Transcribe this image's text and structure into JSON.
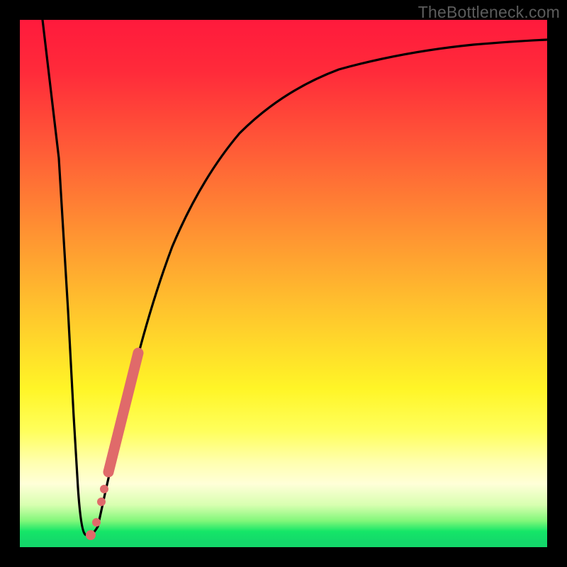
{
  "watermark": "TheBottleneck.com",
  "chart_data": {
    "type": "line",
    "title": "",
    "xlabel": "",
    "ylabel": "",
    "xlim": [
      0,
      100
    ],
    "ylim": [
      0,
      100
    ],
    "background_gradient": {
      "top": "#ff1a3c",
      "mid_upper": "#ff9132",
      "mid": "#fff527",
      "mid_lower": "#ffffb0",
      "bottom": "#13d86a"
    },
    "series": [
      {
        "name": "bottleneck-curve",
        "color": "#000000",
        "x": [
          4,
          6,
          8,
          9,
          10,
          11,
          12,
          13,
          14,
          15,
          17,
          19,
          21,
          24,
          27,
          31,
          36,
          42,
          50,
          60,
          72,
          85,
          100
        ],
        "y": [
          100,
          70,
          35,
          15,
          3,
          1,
          2,
          4,
          8,
          13,
          23,
          33,
          42,
          52,
          60,
          67,
          73,
          78,
          82,
          86,
          89,
          91,
          93
        ]
      }
    ],
    "markers": [
      {
        "name": "highlight-segment",
        "shape": "thick-stroke",
        "color": "#e06a6a",
        "x": [
          16.5,
          21.5
        ],
        "y": [
          20,
          44
        ]
      },
      {
        "name": "dot-1",
        "shape": "circle",
        "color": "#e06a6a",
        "x": 15.3,
        "y": 14
      },
      {
        "name": "dot-2",
        "shape": "circle",
        "color": "#e06a6a",
        "x": 14.7,
        "y": 11
      },
      {
        "name": "dot-3",
        "shape": "circle",
        "color": "#e06a6a",
        "x": 13.3,
        "y": 5
      },
      {
        "name": "dot-4",
        "shape": "circle",
        "color": "#e06a6a",
        "x": 12.2,
        "y": 2.5
      }
    ]
  }
}
